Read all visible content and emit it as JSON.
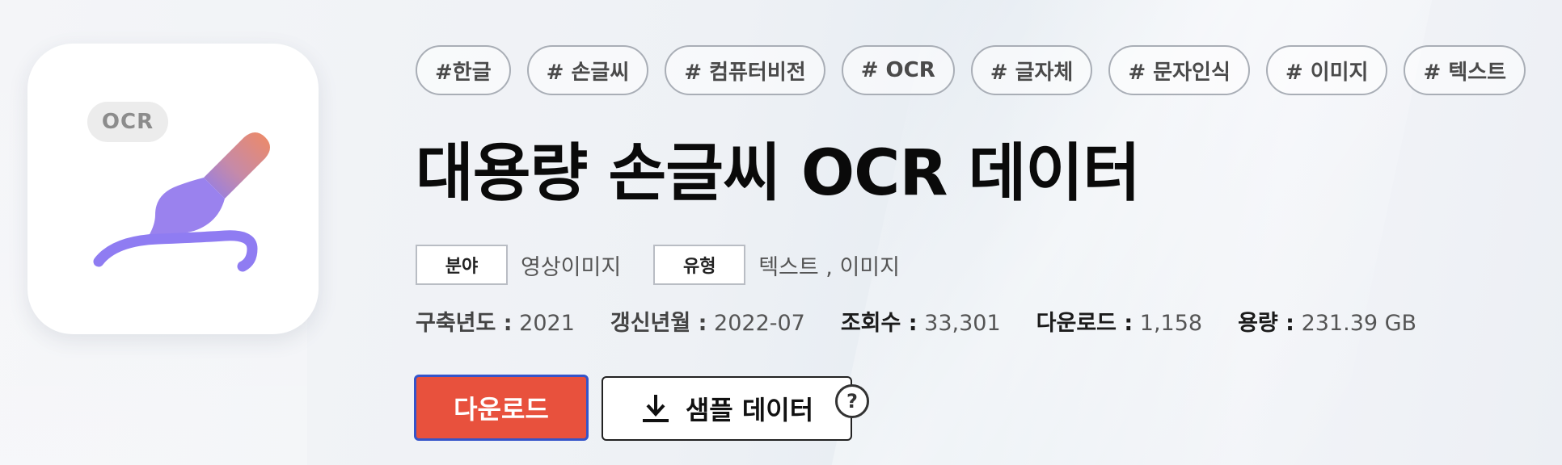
{
  "thumbnail": {
    "badge": "OCR",
    "icon": "paintbrush-handwriting-icon",
    "colors": {
      "brush_top": "#ee8a6a",
      "brush_bottom": "#8c7cf0",
      "stroke": "#8f7cf2"
    }
  },
  "tags": [
    "#한글",
    "# 손글씨",
    "# 컴퓨터비전",
    "# OCR",
    "# 글자체",
    "# 문자인식",
    "# 이미지",
    "# 텍스트"
  ],
  "title": "대용량 손글씨 OCR 데이터",
  "meta": {
    "field_label": "분야",
    "field_value": "영상이미지",
    "type_label": "유형",
    "type_value": "텍스트 , 이미지"
  },
  "stats": [
    {
      "label": "구축년도 :",
      "value": "2021"
    },
    {
      "label": "갱신년월 :",
      "value": "2022-07"
    },
    {
      "label": "조회수 :",
      "value": "33,301"
    },
    {
      "label": "다운로드 :",
      "value": "1,158"
    },
    {
      "label": "용량 :",
      "value": "231.39 GB"
    }
  ],
  "buttons": {
    "download_label": "다운로드",
    "sample_label": "샘플 데이터",
    "help_glyph": "?"
  },
  "colors": {
    "accent": "#e8513d",
    "focus_border": "#3554c9"
  }
}
